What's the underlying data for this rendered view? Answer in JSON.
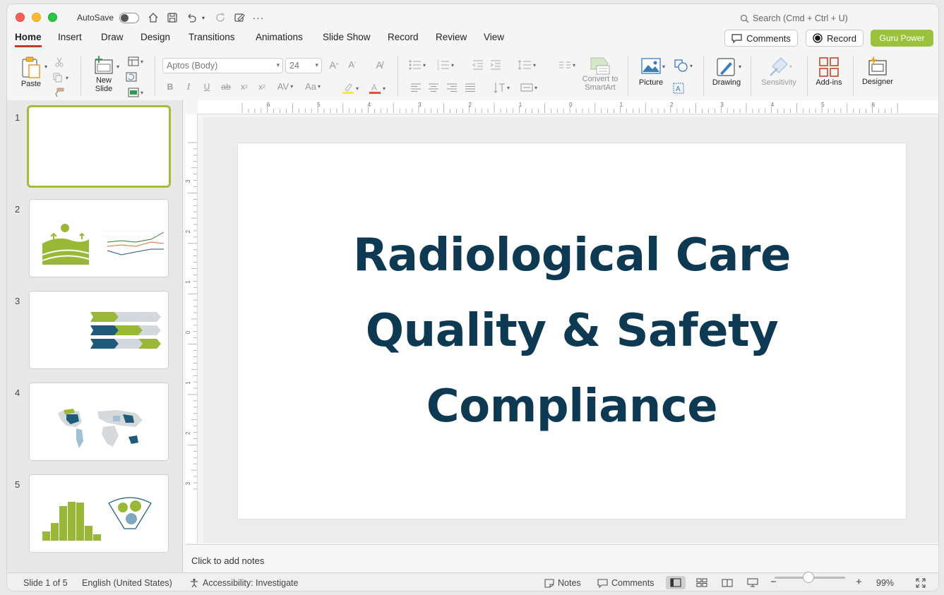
{
  "titlebar": {
    "autosave_label": "AutoSave",
    "search_placeholder": "Search (Cmd + Ctrl + U)"
  },
  "tabs": [
    "Home",
    "Insert",
    "Draw",
    "Design",
    "Transitions",
    "Animations",
    "Slide Show",
    "Record",
    "Review",
    "View"
  ],
  "header_buttons": {
    "comments": "Comments",
    "record": "Record",
    "guru": "Guru Power"
  },
  "ribbon": {
    "paste": "Paste",
    "new_slide_line1": "New",
    "new_slide_line2": "Slide",
    "font_name": "Aptos (Body)",
    "font_size": "24",
    "convert_line1": "Convert to",
    "convert_line2": "SmartArt",
    "picture": "Picture",
    "drawing": "Drawing",
    "sensitivity": "Sensitivity",
    "addins": "Add-ins",
    "designer": "Designer"
  },
  "thumbnails": [
    {
      "num": "1"
    },
    {
      "num": "2"
    },
    {
      "num": "3"
    },
    {
      "num": "4"
    },
    {
      "num": "5"
    }
  ],
  "slide": {
    "title": "Radiological Care\nQuality & Safety\nCompliance",
    "title_color": "#0d3a52"
  },
  "notes_placeholder": "Click to add notes",
  "status": {
    "slide_info": "Slide 1 of 5",
    "language": "English (United States)",
    "accessibility": "Accessibility: Investigate",
    "notes": "Notes",
    "comments": "Comments",
    "zoom": "99%"
  },
  "colors": {
    "accent_tab": "#c43e1c",
    "guru": "#9ac23c",
    "thumb_green": "#9ab838",
    "thumb_blue": "#1f5a7a"
  },
  "ruler_h": [
    "6",
    "5",
    "4",
    "3",
    "2",
    "1",
    "0",
    "1",
    "2",
    "3",
    "4",
    "5",
    "6"
  ],
  "ruler_v": [
    "3",
    "2",
    "1",
    "0",
    "1",
    "2",
    "3"
  ]
}
